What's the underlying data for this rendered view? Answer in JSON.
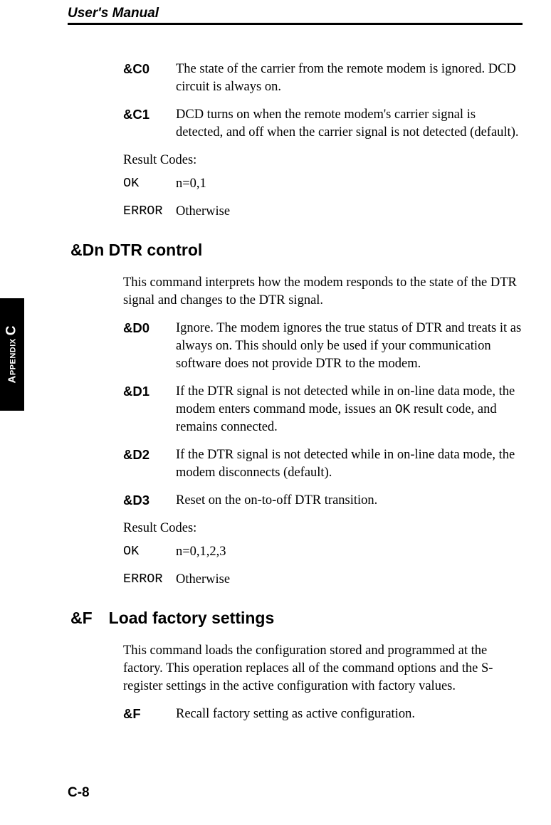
{
  "header": {
    "title": "User's Manual"
  },
  "sideTab": {
    "label_small": "Appendix",
    "label_big": "C"
  },
  "section1": {
    "items": [
      {
        "term": "&C0",
        "def": "The state of the carrier from the remote modem is ignored. DCD circuit is always on."
      },
      {
        "term": "&C1",
        "def": "DCD turns on when the remote modem's carrier signal is detected, and off when the carrier signal is not detected (default)."
      }
    ],
    "resultLabel": "Result Codes:",
    "results": [
      {
        "term": "OK",
        "def": "n=0,1"
      },
      {
        "term": "ERROR",
        "def": "Otherwise"
      }
    ]
  },
  "section2": {
    "heading": "&Dn DTR control",
    "intro": "This command interprets how the modem responds to the state of the DTR signal and changes to the DTR signal.",
    "items": [
      {
        "term": "&D0",
        "def": "Ignore. The modem ignores the true status of DTR and treats it as always on. This should only be used if your communication software does not provide DTR to the modem."
      },
      {
        "term": "&D1",
        "def_pre": "If the DTR signal is not detected while in on-line data mode, the modem enters command mode, issues an ",
        "mono": "OK",
        "def_post": " result code, and remains connected."
      },
      {
        "term": "&D2",
        "def": "If the DTR signal is not detected while in on-line data mode, the modem disconnects (default)."
      },
      {
        "term": "&D3",
        "def": "Reset on the on-to-off DTR transition."
      }
    ],
    "resultLabel": "Result Codes:",
    "results": [
      {
        "term": "OK",
        "def": "n=0,1,2,3"
      },
      {
        "term": "ERROR",
        "def": "Otherwise"
      }
    ]
  },
  "section3": {
    "heading": "&F Load factory settings",
    "intro": "This command loads the configuration stored and programmed at the factory. This operation replaces all of the command options and the S-register settings in the active configuration with factory values.",
    "items": [
      {
        "term": "&F",
        "def": "Recall factory setting as active configuration."
      }
    ]
  },
  "pageNumber": "C-8"
}
